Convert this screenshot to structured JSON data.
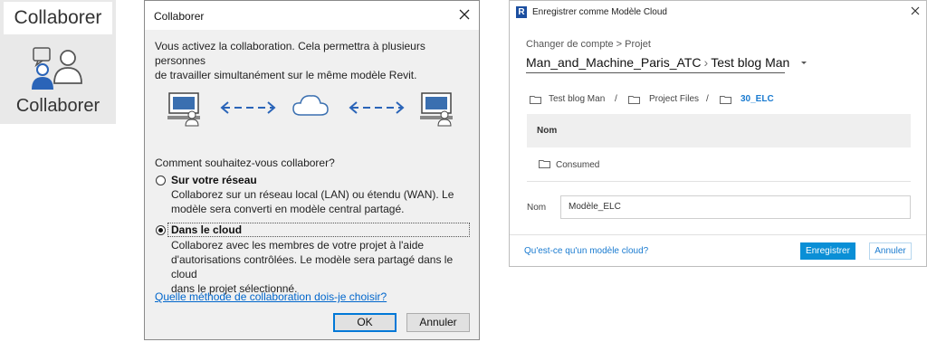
{
  "ribbon": {
    "tab_label": "Collaborer",
    "button_label": "Collaborer",
    "icon": "collaborate-users-icon"
  },
  "collab_dialog": {
    "title": "Collaborer",
    "intro_line1": "Vous activez la collaboration. Cela permettra à plusieurs personnes",
    "intro_line2": "de travailler simultanément sur le même modèle Revit.",
    "question": "Comment souhaitez-vous collaborer?",
    "options": [
      {
        "label": "Sur votre réseau",
        "selected": false,
        "desc_line1": "Collaborez sur un réseau local (LAN) ou étendu (WAN). Le",
        "desc_line2": "modèle sera converti en modèle central partagé."
      },
      {
        "label": "Dans le cloud",
        "selected": true,
        "desc_line1": "Collaborez avec les membres de votre projet à l'aide",
        "desc_line2": "d'autorisations contrôlées. Le modèle sera partagé dans le cloud",
        "desc_line3": "dans le projet sélectionné."
      }
    ],
    "help_link": "Quelle méthode de collaboration dois-je choisir?",
    "ok_label": "OK",
    "cancel_label": "Annuler"
  },
  "cloud_dialog": {
    "title": "Enregistrer comme Modèle Cloud",
    "account_link": "Changer de compte > Projet",
    "account": "Man_and_Machine_Paris_ATC",
    "project": "Test blog Man",
    "breadcrumb": [
      "Test blog Man",
      "Project Files",
      "30_ELC"
    ],
    "breadcrumb_sep": "/",
    "column_header": "Nom",
    "folders": [
      "Consumed"
    ],
    "name_label": "Nom",
    "name_value": "Modèle_ELC",
    "help_link": "Qu'est-ce qu'un modèle cloud?",
    "save_label": "Enregistrer",
    "cancel_label": "Annuler",
    "accent_color": "#0a8fd6"
  },
  "colors": {
    "link": "#0066cc",
    "monitor_blue": "#3a6fb0",
    "arrow_blue": "#2a64b8"
  }
}
